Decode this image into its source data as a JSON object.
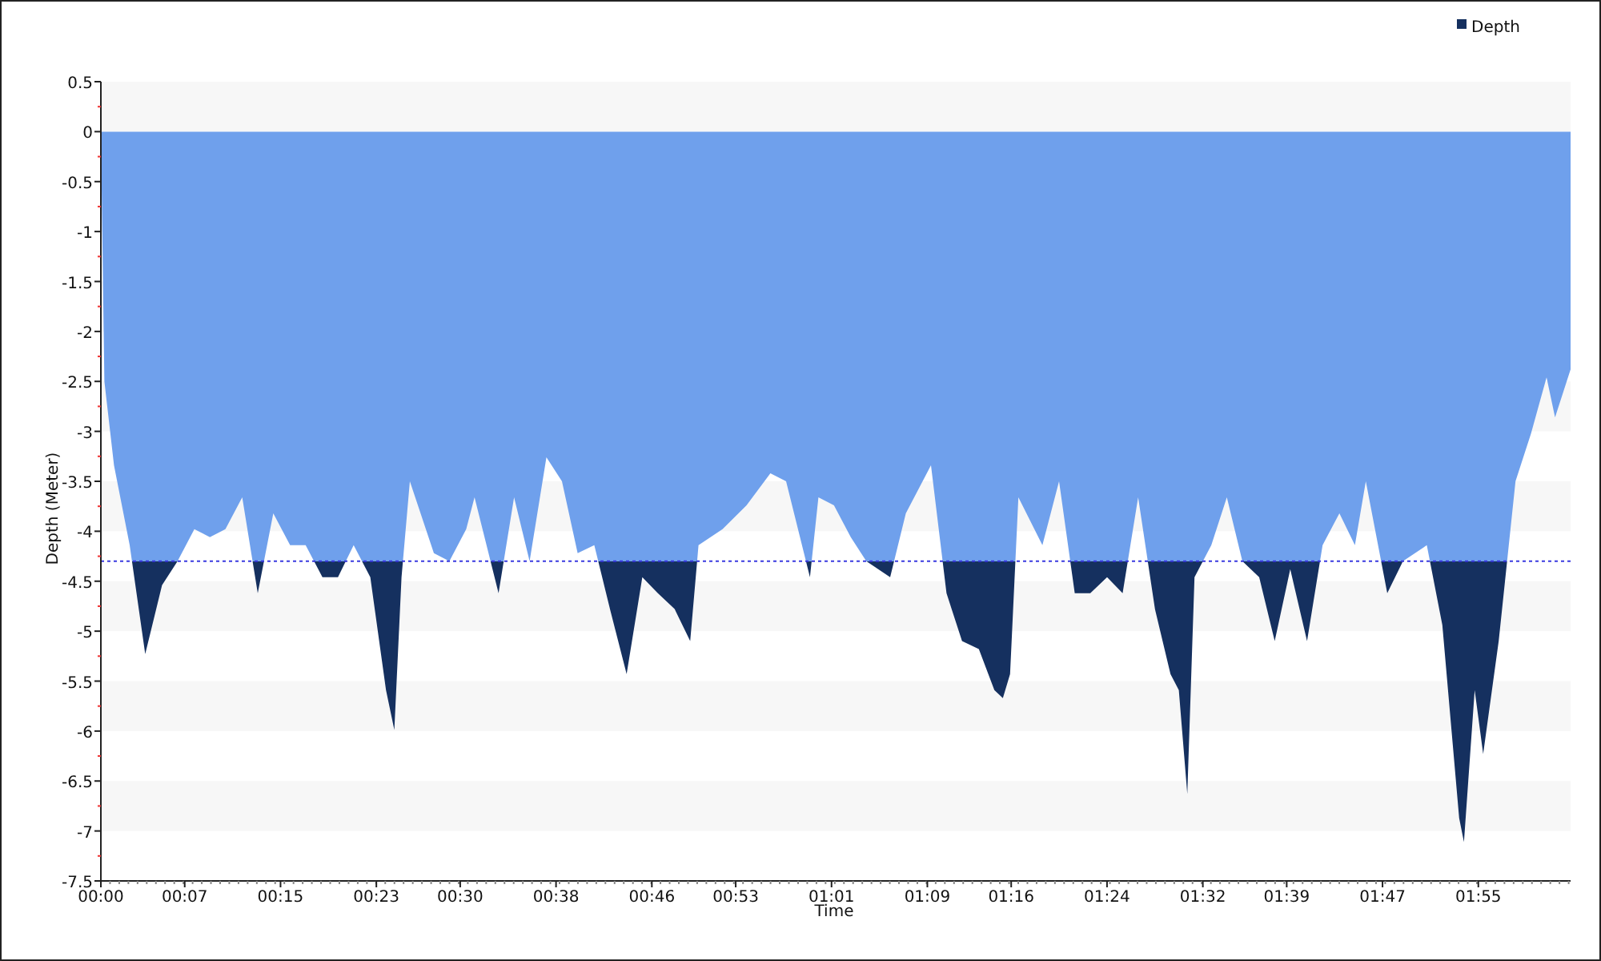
{
  "chart": {
    "chart_data": {
      "type": "area",
      "xlabel": "Time",
      "ylabel": "Depth (Meter)",
      "xlim": [
        0,
        122.7
      ],
      "ylim": [
        -7.5,
        0.5
      ],
      "xticks": [
        {
          "value": 0,
          "label": "00:00"
        },
        {
          "value": 7,
          "label": "00:07"
        },
        {
          "value": 15,
          "label": "00:15"
        },
        {
          "value": 23,
          "label": "00:23"
        },
        {
          "value": 30,
          "label": "00:30"
        },
        {
          "value": 38,
          "label": "00:38"
        },
        {
          "value": 46,
          "label": "00:46"
        },
        {
          "value": 53,
          "label": "00:53"
        },
        {
          "value": 61,
          "label": "01:01"
        },
        {
          "value": 69,
          "label": "01:09"
        },
        {
          "value": 76,
          "label": "01:16"
        },
        {
          "value": 84,
          "label": "01:24"
        },
        {
          "value": 92,
          "label": "01:32"
        },
        {
          "value": 99,
          "label": "01:39"
        },
        {
          "value": 107,
          "label": "01:47"
        },
        {
          "value": 115,
          "label": "01:55"
        }
      ],
      "yticks": [
        0.5,
        0,
        -0.5,
        -1,
        -1.5,
        -2,
        -2.5,
        -3,
        -3.5,
        -4,
        -4.5,
        -5,
        -5.5,
        -6,
        -6.5,
        -7,
        -7.5
      ],
      "x": [
        0,
        0.3,
        1.1,
        2.4,
        3.7,
        5.1,
        6.4,
        7.8,
        9.1,
        10.4,
        11.8,
        13.1,
        14.4,
        15.8,
        17.1,
        18.5,
        19.8,
        21.1,
        22.5,
        23.8,
        24.5,
        25.1,
        25.8,
        27.8,
        29.1,
        30.5,
        31.2,
        33.2,
        34.5,
        35.8,
        37.2,
        38.5,
        39.8,
        41.2,
        42.5,
        43.9,
        45.2,
        46.5,
        47.9,
        49.2,
        49.9,
        51.9,
        53.9,
        55.9,
        57.2,
        59.2,
        59.9,
        61.2,
        62.6,
        63.9,
        65.9,
        67.2,
        69.3,
        70.6,
        71.9,
        73.3,
        74.6,
        75.3,
        75.9,
        76.6,
        78.6,
        80.0,
        81.3,
        82.6,
        84.0,
        85.3,
        86.6,
        88.0,
        89.3,
        90.0,
        90.7,
        91.3,
        92.7,
        94.0,
        95.3,
        96.7,
        98.0,
        99.3,
        100.7,
        102.0,
        103.4,
        104.7,
        105.6,
        107.4,
        108.7,
        110.7,
        112.0,
        113.4,
        113.8,
        114.7,
        115.4,
        116.7,
        118.1,
        119.4,
        120.7,
        121.4,
        122.7
      ],
      "series": [
        {
          "name": "Depth",
          "color": "#15305f",
          "values": [
            0,
            -2.5,
            -3.34,
            -4.14,
            -5.23,
            -4.54,
            -4.3,
            -3.98,
            -4.06,
            -3.98,
            -3.66,
            -4.62,
            -3.82,
            -4.14,
            -4.14,
            -4.46,
            -4.46,
            -4.14,
            -4.46,
            -5.59,
            -5.99,
            -4.46,
            -3.5,
            -4.22,
            -4.3,
            -3.98,
            -3.66,
            -4.62,
            -3.66,
            -4.3,
            -3.26,
            -3.5,
            -4.22,
            -4.14,
            -4.78,
            -5.43,
            -4.46,
            -4.62,
            -4.78,
            -5.1,
            -4.14,
            -3.98,
            -3.74,
            -3.42,
            -3.5,
            -4.46,
            -3.66,
            -3.74,
            -4.06,
            -4.3,
            -4.46,
            -3.82,
            -3.34,
            -4.62,
            -5.1,
            -5.18,
            -5.59,
            -5.67,
            -5.43,
            -3.66,
            -4.14,
            -3.5,
            -4.62,
            -4.62,
            -4.46,
            -4.62,
            -3.66,
            -4.78,
            -5.43,
            -5.59,
            -6.63,
            -4.46,
            -4.14,
            -3.66,
            -4.3,
            -4.46,
            -5.1,
            -4.38,
            -5.1,
            -4.14,
            -3.82,
            -4.14,
            -3.5,
            -4.62,
            -4.3,
            -4.14,
            -4.94,
            -6.87,
            -7.11,
            -5.59,
            -6.23,
            -5.1,
            -3.5,
            -3.02,
            -2.46,
            -2.86,
            -2.38
          ]
        }
      ],
      "ref_lines": [
        {
          "axis": "y",
          "value": -4.3,
          "color": "#3a3ae0"
        }
      ]
    }
  }
}
